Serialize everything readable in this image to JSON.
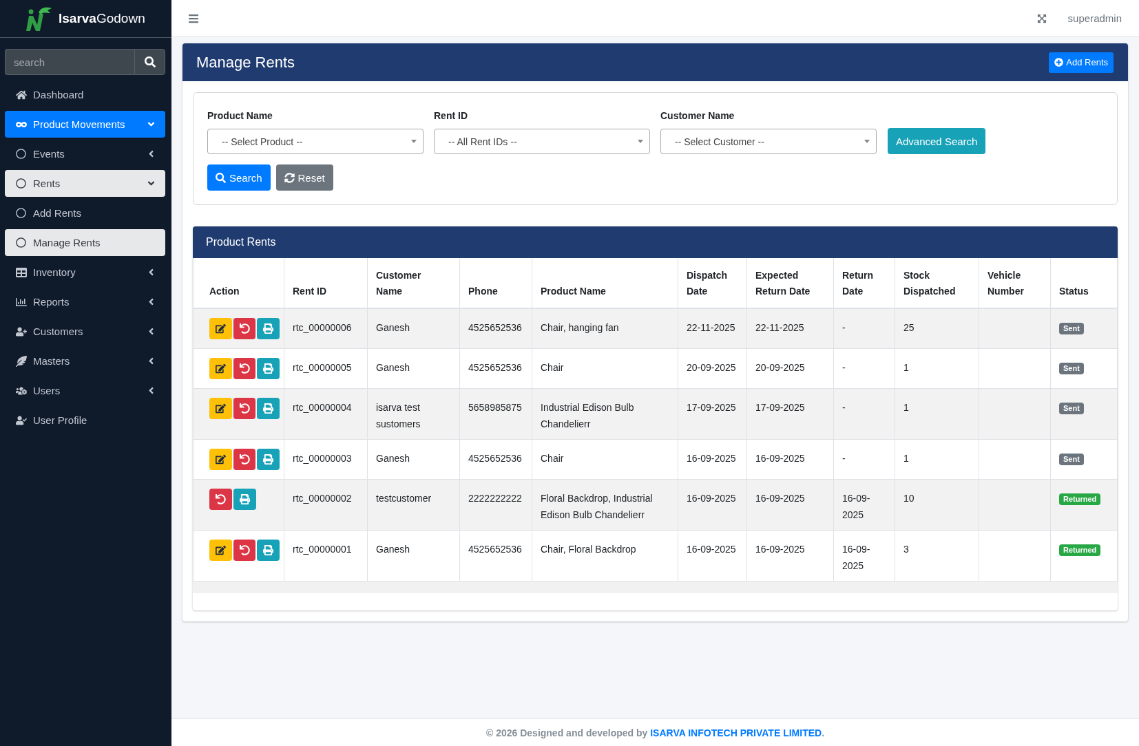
{
  "sidebar": {
    "brand": "**Isarva**Godown",
    "search": {
      "placeholder": "search"
    },
    "items": [
      {
        "label": "Dashboard",
        "selected": false
      },
      {
        "label": "Product Movements",
        "selected": true,
        "expanded": true,
        "children": [
          {
            "label": "Events",
            "selected": false,
            "expanded": false
          },
          {
            "label": "Rents",
            "selected": true,
            "expanded": true,
            "children": [
              {
                "label": "Add Rents",
                "selected": false
              },
              {
                "label": "Manage Rents",
                "selected": true
              }
            ]
          }
        ]
      },
      {
        "label": "Inventory",
        "selected": false,
        "expanded": false
      },
      {
        "label": "Reports",
        "selected": false,
        "expanded": false
      },
      {
        "label": "Customers",
        "selected": false,
        "expanded": false
      },
      {
        "label": "Masters",
        "selected": false,
        "expanded": false
      },
      {
        "label": "Users",
        "selected": false,
        "expanded": false
      },
      {
        "label": "User Profile",
        "selected": false
      }
    ]
  },
  "navbar": {
    "user": "superadmin"
  },
  "page": {
    "title": "Manage Rents",
    "add_button": "Add Rents"
  },
  "filters": {
    "fields": [
      {
        "label": "Product Name",
        "value": "-- Select Product --"
      },
      {
        "label": "Rent ID",
        "value": "-- All Rent IDs --"
      },
      {
        "label": "Customer Name",
        "value": "-- Select Customer --"
      }
    ],
    "advanced_button": "Advanced Search",
    "buttons": [
      {
        "kind": "search",
        "label": "Search"
      },
      {
        "kind": "reset",
        "label": "Reset"
      }
    ]
  },
  "table": {
    "title": "Product Rents",
    "columns": [
      "Action",
      "Rent ID",
      "Customer Name",
      "Phone",
      "Product Name",
      "Dispatch Date",
      "Expected Return Date",
      "Return Date",
      "Stock Dispatched",
      "Vehicle Number",
      "Status"
    ],
    "rows": [
      {
        "actions": [
          {
            "kind": "edit"
          },
          {
            "kind": "undo"
          },
          {
            "kind": "print"
          }
        ],
        "rent_id": "rtc_00000006",
        "customer_name": "Ganesh",
        "phone": "4525652536",
        "product_name": "Chair, hanging fan",
        "dispatch_date": "22-11-2025",
        "expected_return_date": "22-11-2025",
        "return_date": "-",
        "stock_dispatched": "25",
        "status": {
          "label": "Sent",
          "color": "#6c757d"
        }
      },
      {
        "actions": [
          {
            "kind": "edit"
          },
          {
            "kind": "undo"
          },
          {
            "kind": "print"
          }
        ],
        "rent_id": "rtc_00000005",
        "customer_name": "Ganesh",
        "phone": "4525652536",
        "product_name": "Chair",
        "dispatch_date": "20-09-2025",
        "expected_return_date": "20-09-2025",
        "return_date": "-",
        "stock_dispatched": "1",
        "status": {
          "label": "Sent",
          "color": "#6c757d"
        }
      },
      {
        "actions": [
          {
            "kind": "edit"
          },
          {
            "kind": "undo"
          },
          {
            "kind": "print"
          }
        ],
        "rent_id": "rtc_00000004",
        "customer_name": "isarva test sustomers",
        "phone": "5658985875",
        "product_name": "Industrial Edison Bulb Chandelierr",
        "dispatch_date": "17-09-2025",
        "expected_return_date": "17-09-2025",
        "return_date": "-",
        "stock_dispatched": "1",
        "status": {
          "label": "Sent",
          "color": "#6c757d"
        }
      },
      {
        "actions": [
          {
            "kind": "edit"
          },
          {
            "kind": "undo"
          },
          {
            "kind": "print"
          }
        ],
        "rent_id": "rtc_00000003",
        "customer_name": "Ganesh",
        "phone": "4525652536",
        "product_name": "Chair",
        "dispatch_date": "16-09-2025",
        "expected_return_date": "16-09-2025",
        "return_date": "-",
        "stock_dispatched": "1",
        "status": {
          "label": "Sent",
          "color": "#6c757d"
        }
      },
      {
        "actions": [
          {
            "kind": "undo"
          },
          {
            "kind": "print"
          }
        ],
        "rent_id": "rtc_00000002",
        "customer_name": "testcustomer",
        "phone": "2222222222",
        "product_name": "Floral Backdrop, Industrial Edison Bulb Chandelierr",
        "dispatch_date": "16-09-2025",
        "expected_return_date": "16-09-2025",
        "return_date": "16-09-2025",
        "stock_dispatched": "10",
        "status": {
          "label": "Returned",
          "color": "#28a745"
        }
      },
      {
        "actions": [
          {
            "kind": "edit"
          },
          {
            "kind": "undo"
          },
          {
            "kind": "print"
          }
        ],
        "rent_id": "rtc_00000001",
        "customer_name": "Ganesh",
        "phone": "4525652536",
        "product_name": "Chair, Floral Backdrop",
        "dispatch_date": "16-09-2025",
        "expected_return_date": "16-09-2025",
        "return_date": "16-09-2025",
        "stock_dispatched": "3",
        "status": {
          "label": "Returned",
          "color": "#28a745"
        }
      }
    ]
  },
  "footer": {
    "text": "© 2026 Designed and developed by",
    "link": "ISARVA INFOTECH PRIVATE LIMITED",
    "end": "."
  }
}
